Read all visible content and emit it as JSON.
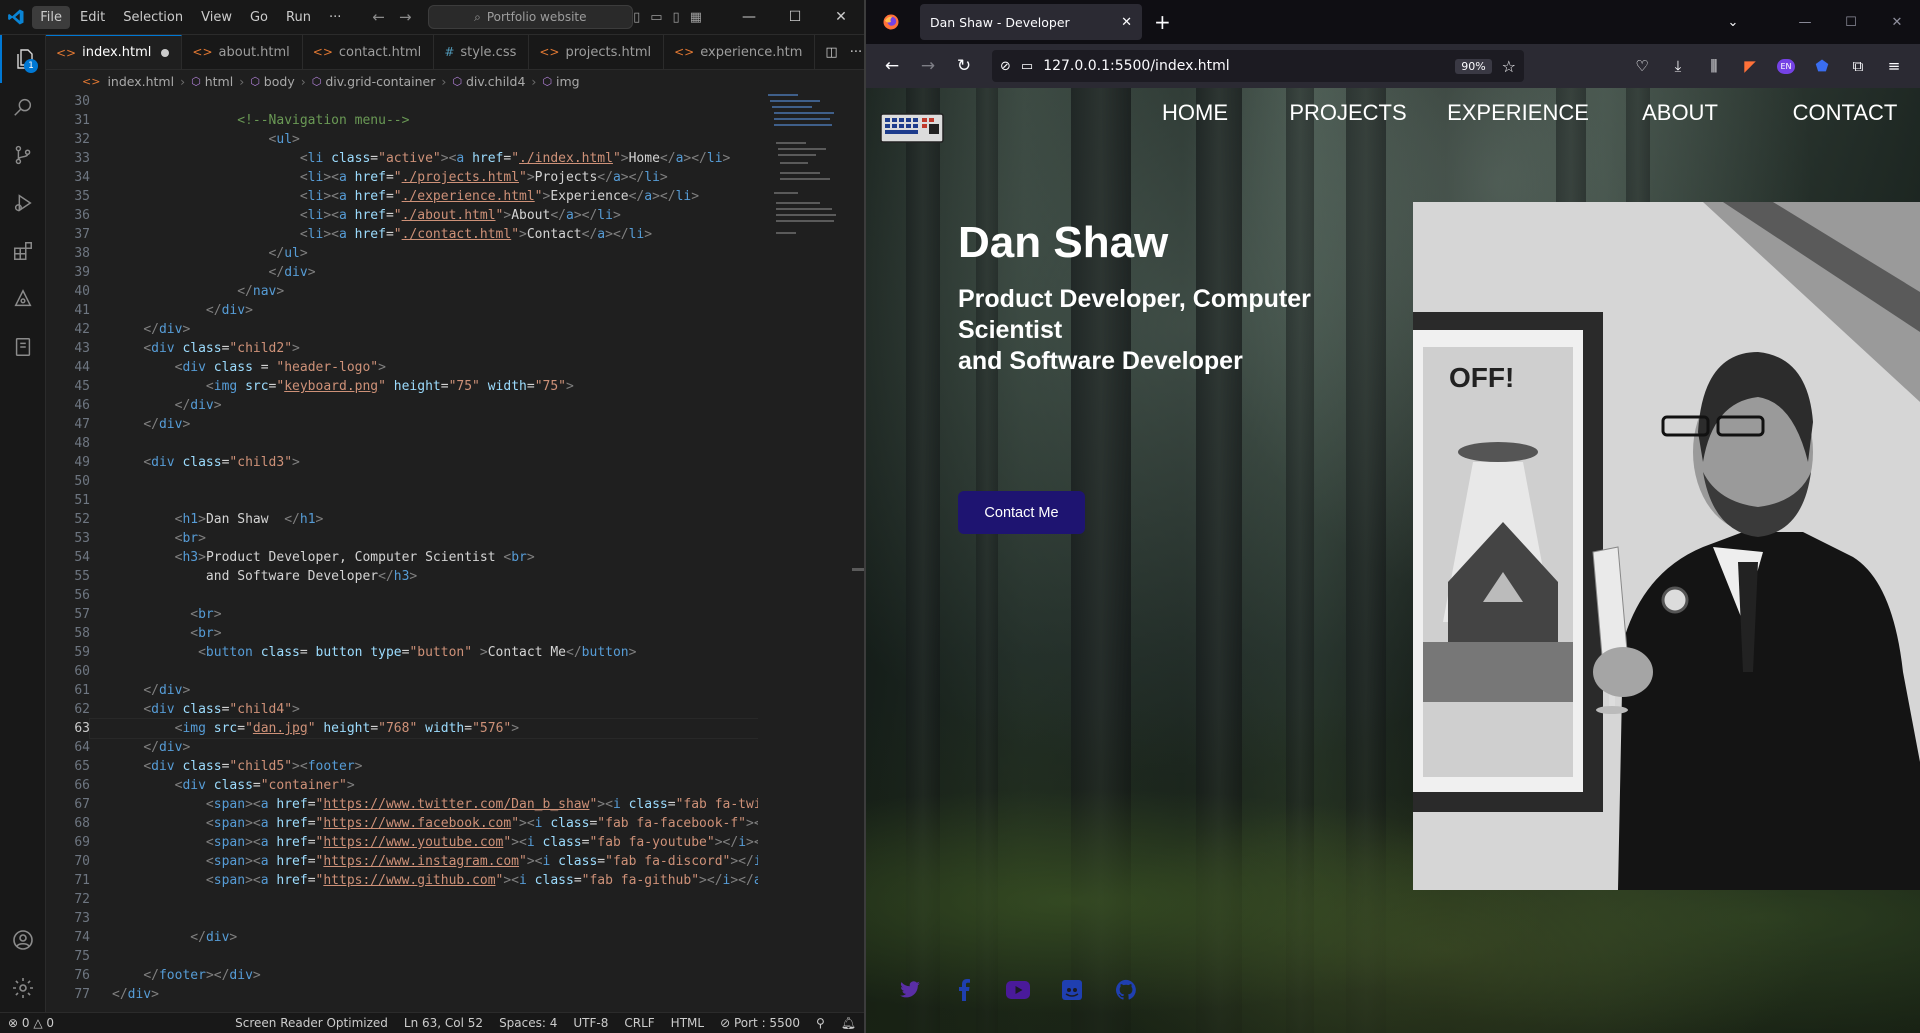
{
  "vscode": {
    "menu": [
      "File",
      "Edit",
      "Selection",
      "View",
      "Go",
      "Run",
      "···"
    ],
    "command_center": "Portfolio website",
    "explorer_badge": "1",
    "tabs": [
      {
        "label": "index.html",
        "active": true,
        "modified": true,
        "type": "html"
      },
      {
        "label": "about.html",
        "type": "html"
      },
      {
        "label": "contact.html",
        "type": "html"
      },
      {
        "label": "style.css",
        "type": "css"
      },
      {
        "label": "projects.html",
        "type": "html"
      },
      {
        "label": "experience.htm",
        "type": "html"
      }
    ],
    "breadcrumbs": [
      "index.html",
      "html",
      "body",
      "div.grid-container",
      "div.child4",
      "img"
    ],
    "status": {
      "errors": "0",
      "warnings": "0",
      "screen_reader": "Screen Reader Optimized",
      "position": "Ln 63, Col 52",
      "spaces": "Spaces: 4",
      "encoding": "UTF-8",
      "eol": "CRLF",
      "language": "HTML",
      "port": "Port : 5500"
    },
    "current_line": "63"
  },
  "firefox": {
    "tab_title": "Dan Shaw - Developer",
    "url": "127.0.0.1:5500/index.html",
    "zoom": "90%",
    "ext_badge": "EN"
  },
  "site": {
    "nav": [
      "HOME",
      "PROJECTS",
      "EXPERIENCE",
      "ABOUT",
      "CONTACT"
    ],
    "name": "Dan Shaw",
    "subtitle_line1": "Product Developer, Computer Scientist",
    "subtitle_line2": "and Software Developer",
    "contact_button": "Contact Me",
    "poster_text": "OFF!",
    "social": [
      "twitter-icon",
      "facebook-icon",
      "youtube-icon",
      "discord-icon",
      "github-icon"
    ],
    "social_colors": {
      "twitter": "#5a2ea6",
      "facebook": "#1f3fb0",
      "youtube": "#4a1a9a",
      "discord": "#1f3fb0",
      "github": "#1f3fb0"
    }
  }
}
